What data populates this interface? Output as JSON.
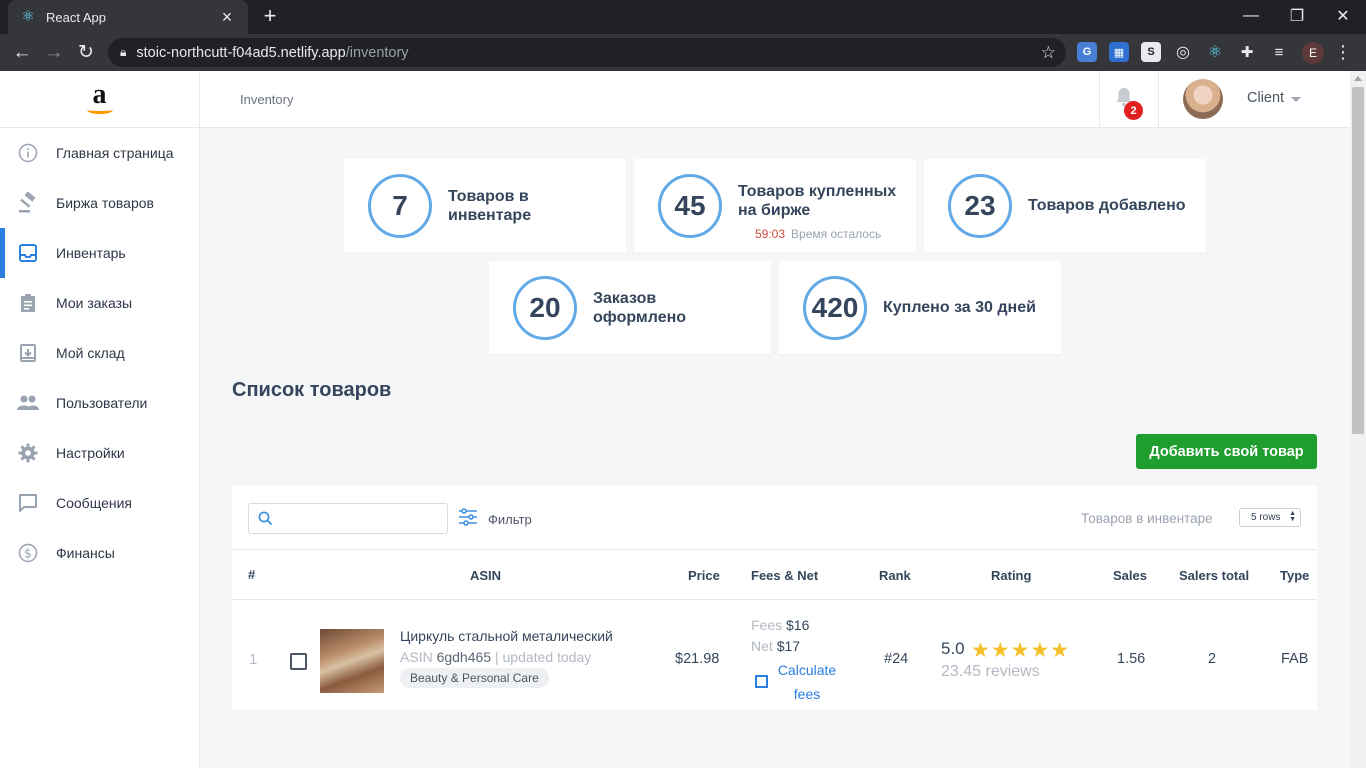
{
  "browser": {
    "tab_title": "React App",
    "url_host": "stoic-northcutt-f04ad5.netlify.app",
    "url_path": "/inventory",
    "profile_initial": "E"
  },
  "sidebar": {
    "items": [
      {
        "label": "Главная страница",
        "icon": "info-icon"
      },
      {
        "label": "Биржа товаров",
        "icon": "gavel-icon"
      },
      {
        "label": "Инвентарь",
        "icon": "inbox-icon",
        "active": true
      },
      {
        "label": "Мои заказы",
        "icon": "clipboard-icon"
      },
      {
        "label": "Мой склад",
        "icon": "archive-icon"
      },
      {
        "label": "Пользователи",
        "icon": "users-icon"
      },
      {
        "label": "Настройки",
        "icon": "gear-icon"
      },
      {
        "label": "Сообщения",
        "icon": "chat-icon"
      },
      {
        "label": "Финансы",
        "icon": "dollar-icon"
      }
    ]
  },
  "topbar": {
    "breadcrumb": "Inventory",
    "notification_count": "2",
    "user_name": "Client"
  },
  "stats": [
    {
      "value": "7",
      "label": "Товаров в инвентаре"
    },
    {
      "value": "45",
      "label": "Товаров купленных на бирже",
      "timer": "59:03",
      "timer_label": "Время осталось"
    },
    {
      "value": "23",
      "label": "Товаров добавлено"
    },
    {
      "value": "20",
      "label": "Заказов оформлено"
    },
    {
      "value": "420",
      "label": "Куплено за 30 дней"
    }
  ],
  "products": {
    "title": "Список товаров",
    "add_button": "Добавить свой товар",
    "filter_label": "Фильтр",
    "inventory_label": "Товаров в инвентаре",
    "rows_select": "5 rows",
    "columns": [
      "#",
      "ASIN",
      "Price",
      "Fees & Net",
      "Rank",
      "Rating",
      "Sales",
      "Salers total",
      "Type"
    ],
    "rows": [
      {
        "index": "1",
        "name": "Циркуль стальной металический",
        "asin_label": "ASIN",
        "asin": "6gdh465",
        "updated": "| updated today",
        "category": "Beauty & Personal Care",
        "price": "$21.98",
        "fees_label": "Fees",
        "fees": "$16",
        "net_label": "Net",
        "net": "$17",
        "calc_line1": "Calculate",
        "calc_line2": "fees",
        "rank": "#24",
        "rating": "5.0",
        "stars": "★★★★★",
        "reviews": "23.45 reviews",
        "sales": "1.56",
        "salers_total": "2",
        "type": "FAB"
      }
    ]
  },
  "colors": {
    "accent": "#2b7fe0",
    "add_button": "#1f9e2f",
    "circle": "#62a9e8",
    "badge": "#e02020"
  }
}
